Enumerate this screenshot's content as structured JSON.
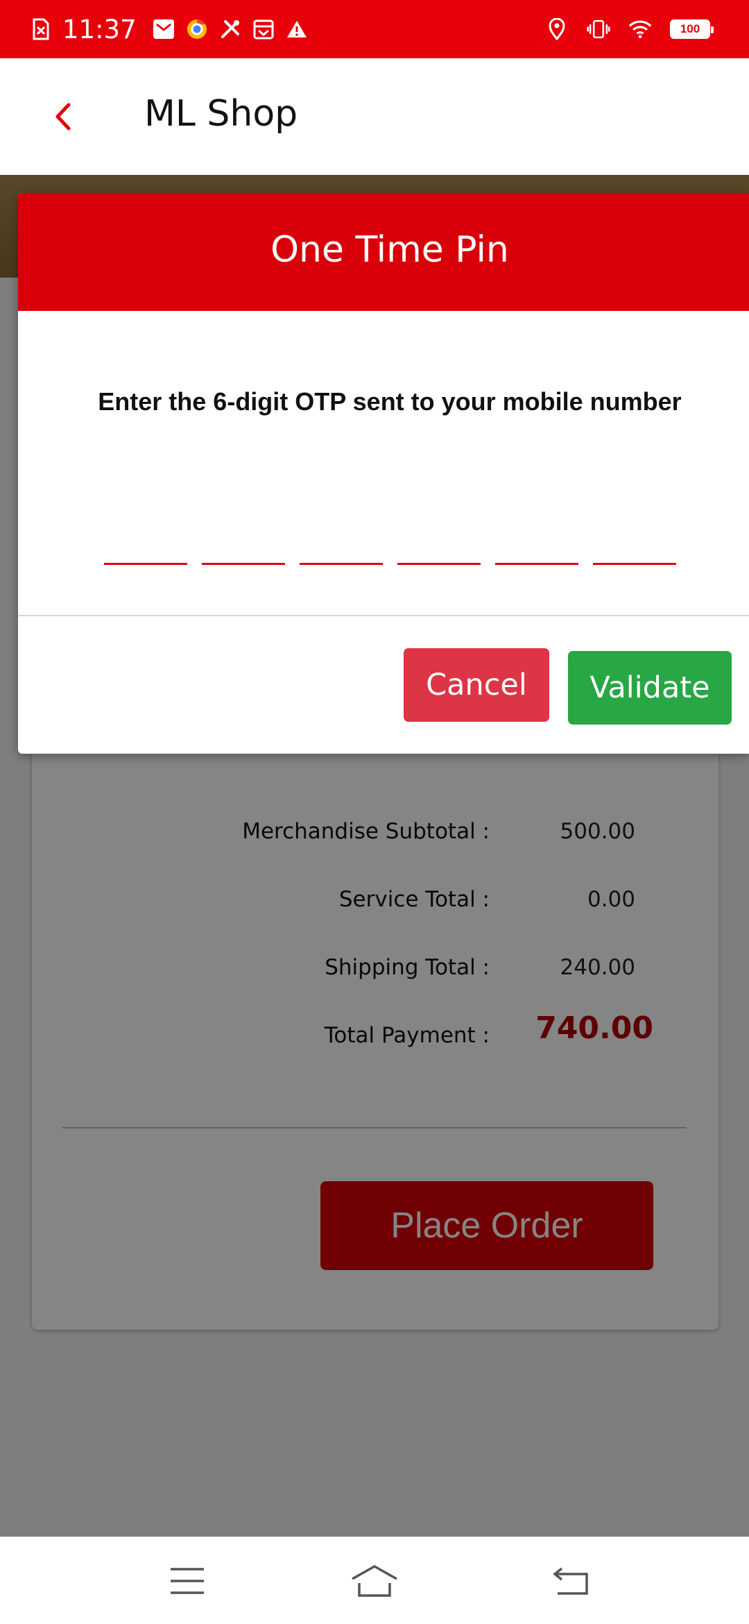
{
  "status_bar": {
    "time": "11:37",
    "left_icons": [
      "sim-error-icon",
      "mail-icon",
      "browser-icon",
      "tools-icon",
      "calendar-icon",
      "warning-icon"
    ],
    "right_icons": [
      "location-icon",
      "vibrate-icon",
      "wifi-icon",
      "battery-icon"
    ],
    "battery": "100",
    "background_color": "#e8000b"
  },
  "app_bar": {
    "title": "ML Shop",
    "back_icon": "chevron-left-icon",
    "accent_color": "#e8000b"
  },
  "order_summary": {
    "rows": [
      {
        "label": "Merchandise Subtotal :",
        "value": "500.00"
      },
      {
        "label": "Service Total :",
        "value": "0.00"
      },
      {
        "label": "Shipping Total :",
        "value": "240.00"
      },
      {
        "label": "Total Payment :",
        "value": "740.00"
      }
    ],
    "place_order_label": "Place Order",
    "total_color": "#b3000a"
  },
  "otp_modal": {
    "title": "One Time Pin",
    "instruction": "Enter the 6-digit OTP sent to your mobile number",
    "digits": [
      "",
      "",
      "",
      "",
      "",
      ""
    ],
    "cancel_label": "Cancel",
    "validate_label": "Validate",
    "header_color": "#d9000a",
    "cancel_color": "#dc3545",
    "validate_color": "#28a745"
  },
  "nav_bar": {
    "items": [
      "menu-icon",
      "home-icon",
      "back-icon"
    ]
  }
}
